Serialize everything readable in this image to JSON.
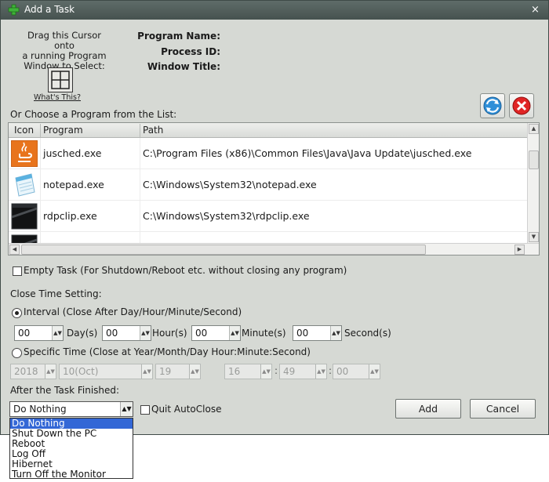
{
  "window": {
    "title": "Add a Task",
    "close_glyph": "×"
  },
  "picker": {
    "instr1": "Drag this Cursor onto",
    "instr2": "a running Program",
    "instr3": "Window to Select:",
    "whats_this": "What's This?",
    "program_name_label": "Program Name:",
    "process_id_label": "Process ID:",
    "window_title_label": "Window Title:"
  },
  "list": {
    "label": "Or Choose a Program from the List:",
    "columns": [
      "Icon",
      "Program",
      "Path"
    ],
    "rows": [
      {
        "program": "jusched.exe",
        "path": "C:\\Program Files (x86)\\Common Files\\Java\\Java Update\\jusched.exe",
        "icon": "java-icon"
      },
      {
        "program": "notepad.exe",
        "path": "C:\\Windows\\System32\\notepad.exe",
        "icon": "notepad-icon"
      },
      {
        "program": "rdpclip.exe",
        "path": "C:\\Windows\\System32\\rdpclip.exe",
        "icon": "program-window-icon"
      }
    ]
  },
  "options": {
    "empty_task": "Empty Task (For Shutdown/Reboot etc. without closing any program)",
    "close_time_setting": "Close Time Setting:",
    "interval_label": "Interval (Close After Day/Hour/Minute/Second)",
    "interval": [
      {
        "value": "00",
        "unit": "Day(s)"
      },
      {
        "value": "00",
        "unit": "Hour(s)"
      },
      {
        "value": "00",
        "unit": "Minute(s)"
      },
      {
        "value": "00",
        "unit": "Second(s)"
      }
    ],
    "specific_label": "Specific Time (Close at Year/Month/Day Hour:Minute:Second)",
    "specific": {
      "year": "2018",
      "month": "10(Oct)",
      "day": "19",
      "hour": "16",
      "minute": "49",
      "second": "00",
      "sep": ":"
    },
    "after_label": "After the Task Finished:",
    "after_value": "Do Nothing",
    "quit_autoclose": "Quit AutoClose",
    "dropdown_options": [
      "Do Nothing",
      "Shut Down the PC",
      "Reboot",
      "Log Off",
      "Hibernet",
      "Turn Off the Monitor"
    ]
  },
  "buttons": {
    "add": "Add",
    "cancel": "Cancel"
  },
  "colors": {
    "accent": "#3367d6",
    "titlebar": "#4e5a57",
    "dialog_bg": "#d6d9d4"
  }
}
